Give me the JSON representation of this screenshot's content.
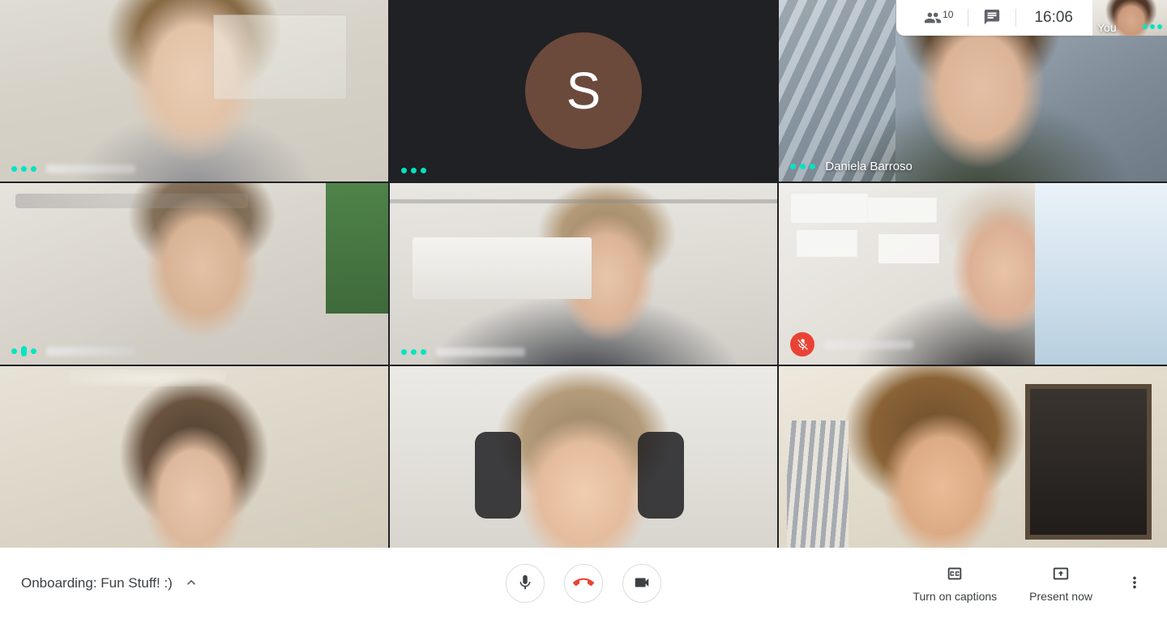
{
  "app": {
    "name": "video-meeting"
  },
  "header": {
    "participants_icon": "people-icon",
    "participant_count": "10",
    "chat_icon": "chat-bubble-icon",
    "clock": "16:06"
  },
  "self_view": {
    "label": "You",
    "voice_active": true
  },
  "grid": {
    "tiles": [
      {
        "id": "tile-1",
        "name": "",
        "name_hidden": true,
        "voice_active": true,
        "muted": false,
        "type": "video"
      },
      {
        "id": "tile-2",
        "name": "",
        "name_hidden": true,
        "voice_active": true,
        "muted": false,
        "type": "avatar",
        "avatar_initial": "S",
        "avatar_color": "#6b4a3b"
      },
      {
        "id": "tile-3",
        "name": "Daniela Barroso",
        "name_hidden": false,
        "voice_active": true,
        "muted": false,
        "type": "video"
      },
      {
        "id": "tile-4",
        "name": "",
        "name_hidden": true,
        "voice_active": true,
        "muted": false,
        "type": "video"
      },
      {
        "id": "tile-5",
        "name": "",
        "name_hidden": true,
        "voice_active": true,
        "muted": false,
        "type": "video"
      },
      {
        "id": "tile-6",
        "name": "",
        "name_hidden": true,
        "voice_active": false,
        "muted": true,
        "type": "video"
      },
      {
        "id": "tile-7",
        "name": "",
        "name_hidden": true,
        "voice_active": false,
        "muted": false,
        "type": "video"
      },
      {
        "id": "tile-8",
        "name": "",
        "name_hidden": true,
        "voice_active": false,
        "muted": false,
        "type": "video"
      },
      {
        "id": "tile-9",
        "name": "",
        "name_hidden": true,
        "voice_active": false,
        "muted": false,
        "type": "video"
      }
    ]
  },
  "toolbar": {
    "meeting_title": "Onboarding: Fun Stuff! :)",
    "expand_icon": "chevron-up-icon",
    "mic_icon": "microphone-icon",
    "hangup_icon": "end-call-icon",
    "camera_icon": "video-camera-icon",
    "captions_label": "Turn on captions",
    "captions_icon": "closed-caption-icon",
    "present_label": "Present now",
    "present_icon": "present-screen-icon",
    "more_icon": "more-vertical-icon"
  },
  "colors": {
    "accent_voice": "#00e5c0",
    "danger": "#ea4335",
    "surface": "#ffffff",
    "text_primary": "#3c4043",
    "text_secondary": "#5f6368",
    "grid_background": "#202124"
  }
}
